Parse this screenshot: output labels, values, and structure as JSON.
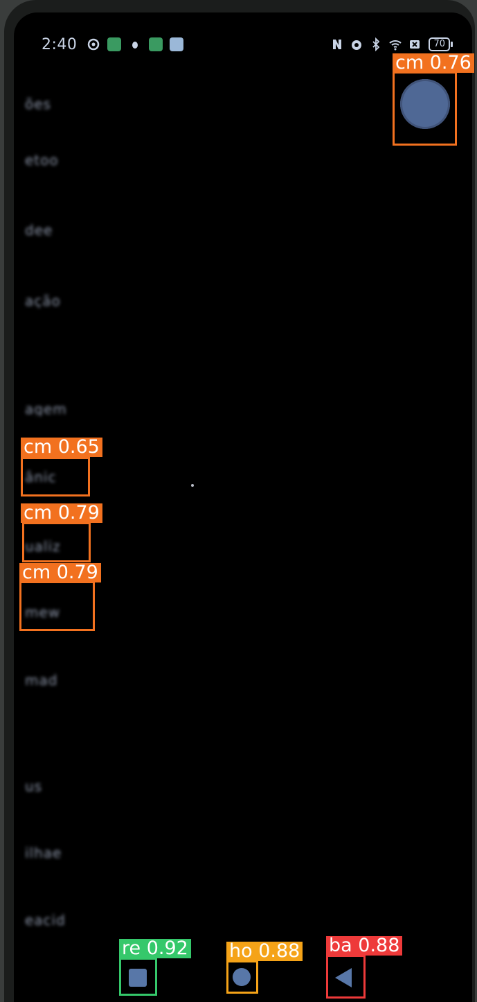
{
  "status_bar": {
    "time": "2:40",
    "battery": "70",
    "left_icons": [
      "settings-icon",
      "grid-app-icon",
      "bug-icon",
      "app-icon",
      "message-icon"
    ],
    "right_icons": [
      "nfc-icon",
      "alarm-icon",
      "bluetooth-icon",
      "wifi-icon",
      "sim-icon",
      "battery-icon"
    ]
  },
  "background_list": {
    "items": [
      "ões",
      "etoo",
      "dee",
      "ação",
      "agem",
      "ânic",
      "ualiz",
      "mew",
      "mad",
      "us",
      "ilhae",
      "eacid"
    ]
  },
  "floating_button": {
    "icon": "floating-ball-icon"
  },
  "nav_bar": {
    "recent_icon": "square-icon",
    "home_icon": "circle-icon",
    "back_icon": "triangle-back-icon"
  },
  "detections": [
    {
      "label": "cm 0.76",
      "color": "#f2711f",
      "target": "floating-button"
    },
    {
      "label": "cm 0.65",
      "color": "#f2711f",
      "target": "list-item-6"
    },
    {
      "label": "cm 0.79",
      "color": "#f2711f",
      "target": "list-item-7"
    },
    {
      "label": "cm 0.79",
      "color": "#f2711f",
      "target": "list-item-8"
    },
    {
      "label": "re 0.92",
      "color": "#35c86b",
      "target": "recent-button"
    },
    {
      "label": "ho 0.88",
      "color": "#f5a318",
      "target": "home-button"
    },
    {
      "label": "ba 0.88",
      "color": "#ee3a3a",
      "target": "back-button"
    }
  ]
}
